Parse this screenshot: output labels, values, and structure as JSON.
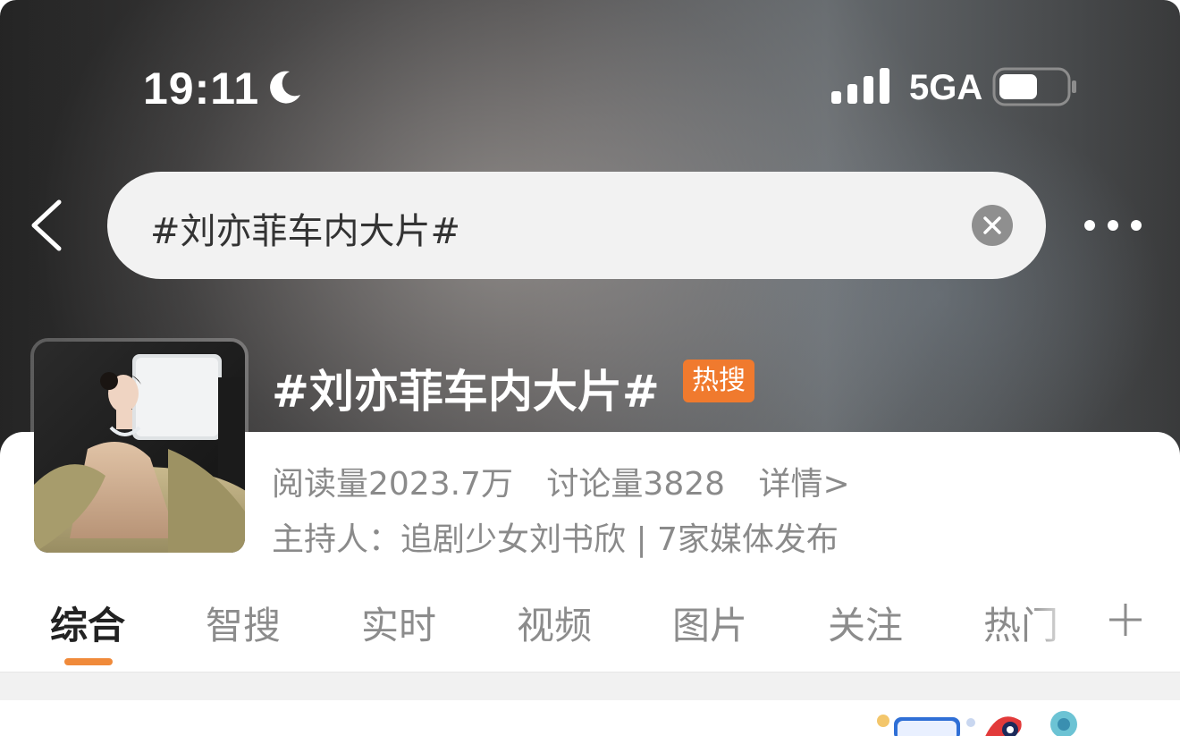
{
  "status_bar": {
    "time": "19:11",
    "network": "5GA",
    "icons": [
      "moon-icon",
      "signal-icon",
      "battery-icon"
    ]
  },
  "search": {
    "query": "#刘亦菲车内大片#",
    "back_icon": "chevron-left-icon",
    "clear_icon": "clear-icon",
    "more_icon": "more-icon"
  },
  "topic": {
    "title": "#刘亦菲车内大片#",
    "badge": "热搜",
    "reads": "阅读量2023.7万",
    "discussions": "讨论量3828",
    "details_link": "详情>",
    "host_line": "主持人：追剧少女刘书欣 | 7家媒体发布"
  },
  "tabs": [
    {
      "label": "综合",
      "active": true
    },
    {
      "label": "智搜",
      "active": false
    },
    {
      "label": "实时",
      "active": false
    },
    {
      "label": "视频",
      "active": false
    },
    {
      "label": "图片",
      "active": false
    },
    {
      "label": "关注",
      "active": false
    },
    {
      "label": "热门",
      "active": false
    }
  ],
  "colors": {
    "accent": "#f08a3a",
    "hot_badge": "#f07a2e",
    "muted_text": "#8a8a8a"
  }
}
